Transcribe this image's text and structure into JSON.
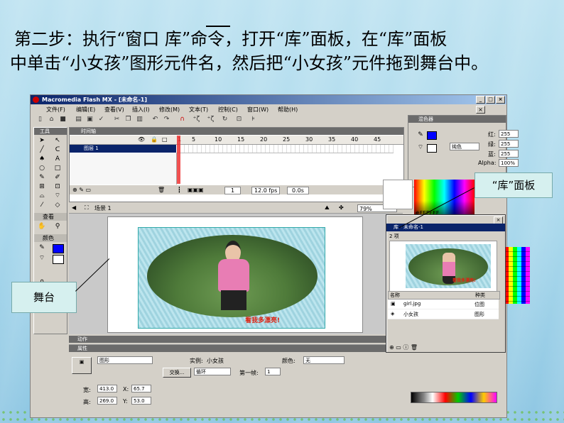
{
  "slide": {
    "line1": "第二步：执行“窗口        库”命令，打开“库”面板，在“库”面板",
    "line2": "中单击“小女孩”图形元件名，然后把“小女孩”元件拖到舞台中。"
  },
  "window": {
    "title": "Macromedia Flash MX - [未命名-1]",
    "menus": [
      "文件(F)",
      "编辑(E)",
      "查看(V)",
      "插入(I)",
      "修改(M)",
      "文本(T)",
      "控制(C)",
      "窗口(W)",
      "帮助(H)"
    ]
  },
  "tools": {
    "header": "工具",
    "view_section": "查看",
    "color_section": "颜色"
  },
  "timeline": {
    "header": "时间轴",
    "ruler": [
      "1",
      "5",
      "10",
      "15",
      "20",
      "25",
      "30",
      "35",
      "40",
      "45"
    ],
    "layer_name": "图层 1",
    "frame": "1",
    "fps": "12.0 fps",
    "time": "0.0s"
  },
  "scene": {
    "name": "场景 1",
    "zoom": "79%"
  },
  "photo_caption": "看我多漂亮!",
  "panels": {
    "actions": "动作",
    "properties": "属性"
  },
  "properties": {
    "type": "图形",
    "instance_label": "实例:",
    "instance_value": "小女孩",
    "color_label": "颜色:",
    "color_value": "无",
    "swap_button": "交换...",
    "loop_value": "循环",
    "first_frame_label": "第一帧:",
    "first_frame_value": "1",
    "w_label": "宽:",
    "w_value": "413.0",
    "x_label": "X:",
    "x_value": "65.7",
    "h_label": "高:",
    "h_value": "269.0",
    "y_label": "Y:",
    "y_value": "53.0"
  },
  "mixer": {
    "header": "混色器",
    "fill_type": "纯色",
    "r_label": "红:",
    "r_value": "255",
    "g_label": "绿:",
    "g_value": "255",
    "b_label": "蓝:",
    "b_value": "255",
    "alpha_label": "Alpha:",
    "alpha_value": "100%",
    "hex": "#FFFFFF"
  },
  "library": {
    "title": "库 - 未命名-1",
    "count": "2 项",
    "col_name": "名称",
    "col_kind": "种类",
    "items": [
      {
        "name": "girl.jpg",
        "kind": "位图"
      },
      {
        "name": "小女孩",
        "kind": "图形"
      }
    ]
  },
  "callouts": {
    "library": "“库”面板",
    "stage": "舞台"
  },
  "colors": {
    "title_blue": "#0a246a",
    "stroke_blue": "#0000ff"
  }
}
